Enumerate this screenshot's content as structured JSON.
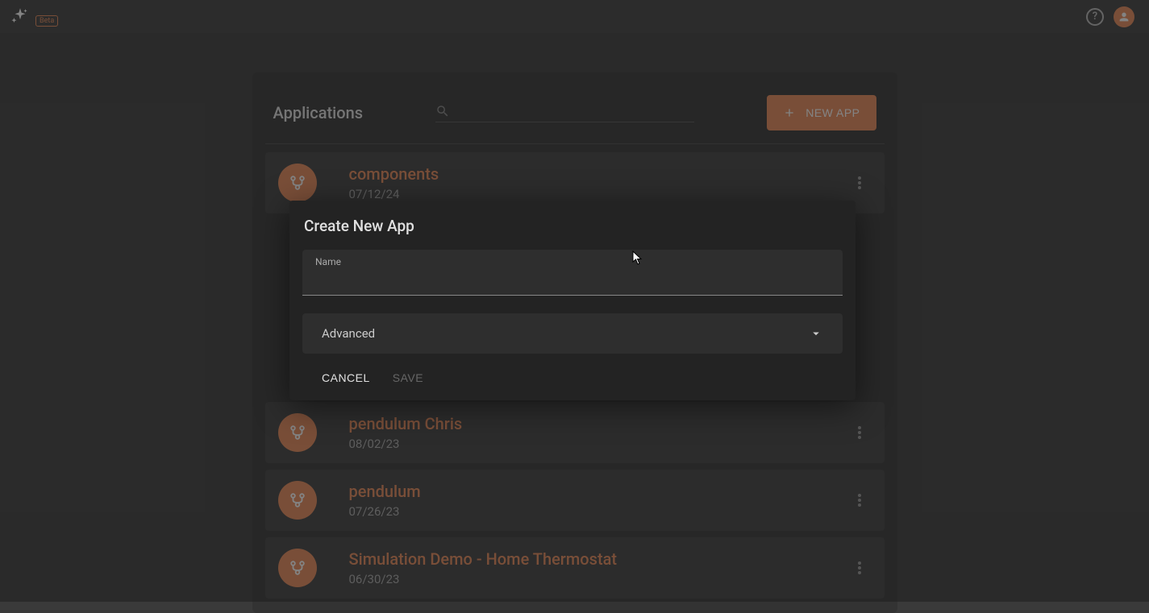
{
  "topbar": {
    "beta_label": "Beta"
  },
  "panel": {
    "title": "Applications",
    "new_app_label": "NEW APP",
    "search_placeholder": ""
  },
  "apps": [
    {
      "name": "components",
      "date": "07/12/24"
    },
    {
      "name": "pendulum Chris",
      "date": "08/02/23"
    },
    {
      "name": "pendulum",
      "date": "07/26/23"
    },
    {
      "name": "Simulation Demo - Home Thermostat",
      "date": "06/30/23"
    }
  ],
  "modal": {
    "title": "Create New App",
    "name_label": "Name",
    "name_value": "",
    "advanced_label": "Advanced",
    "cancel_label": "CANCEL",
    "save_label": "SAVE"
  }
}
